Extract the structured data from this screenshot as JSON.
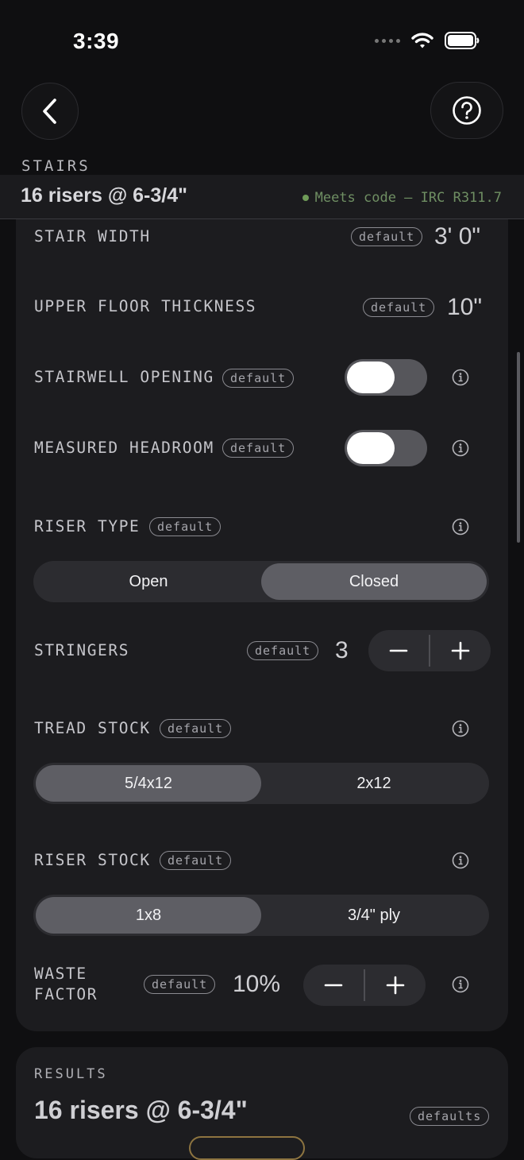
{
  "status_bar": {
    "time": "3:39"
  },
  "header": {
    "section_label": "STAIRS"
  },
  "summary": {
    "title": "16 risers @ 6-3/4\"",
    "code_status": "Meets code — IRC R311.7",
    "code_color": "#6f9b58"
  },
  "fields": {
    "stair_width": {
      "label": "STAIR WIDTH",
      "tag": "default",
      "value": "3' 0\""
    },
    "upper_floor": {
      "label": "UPPER FLOOR THICKNESS",
      "tag": "default",
      "value": "10\""
    },
    "stairwell_opening": {
      "label": "STAIRWELL OPENING",
      "tag": "default",
      "toggle_on": false
    },
    "measured_headroom": {
      "label": "MEASURED HEADROOM",
      "tag": "default",
      "toggle_on": false
    },
    "riser_type": {
      "label": "RISER TYPE",
      "tag": "default",
      "options": [
        "Open",
        "Closed"
      ],
      "selected": "Closed"
    },
    "stringers": {
      "label": "STRINGERS",
      "tag": "default",
      "value": "3"
    },
    "tread_stock": {
      "label": "TREAD STOCK",
      "tag": "default",
      "options": [
        "5/4x12",
        "2x12"
      ],
      "selected": "5/4x12"
    },
    "riser_stock": {
      "label": "RISER STOCK",
      "tag": "default",
      "options": [
        "1x8",
        "3/4\" ply"
      ],
      "selected": "1x8"
    },
    "waste_factor": {
      "label_line1": "WASTE",
      "label_line2": "FACTOR",
      "tag": "default",
      "value": "10%"
    }
  },
  "results": {
    "label": "RESULTS",
    "title": "16 risers @ 6-3/4\"",
    "tag": "defaults"
  },
  "icons": {
    "back": "chevron-left-icon",
    "help": "question-circle-icon",
    "info": "info-circle-icon",
    "minus": "minus-icon",
    "plus": "plus-icon",
    "wifi": "wifi-icon",
    "battery": "battery-icon"
  }
}
